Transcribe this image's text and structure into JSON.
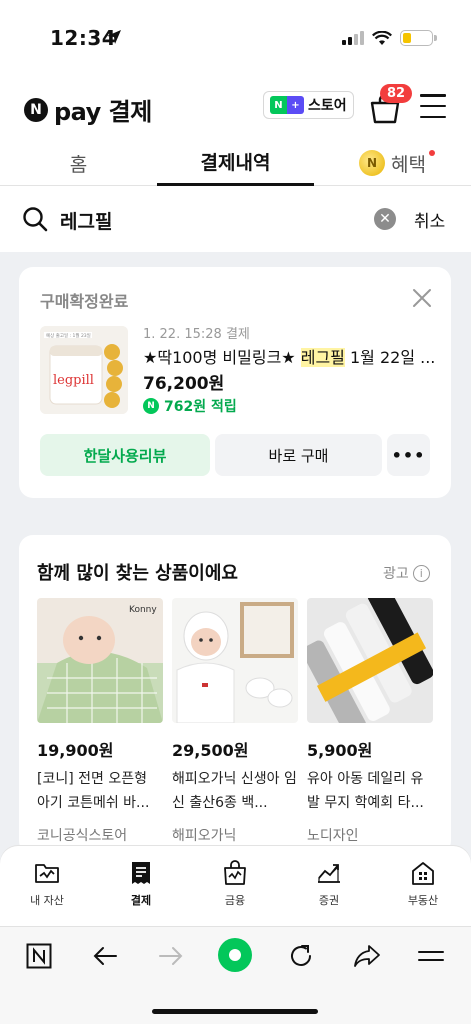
{
  "status_bar": {
    "time": "12:34"
  },
  "header": {
    "logo_letter": "N",
    "logo_text": "pay 결제",
    "store_badge_left": "N",
    "store_badge_right": "+",
    "store_label": "스토어",
    "cart_count": "82"
  },
  "tabs": [
    {
      "label": "홈"
    },
    {
      "label": "결제내역"
    },
    {
      "label": "혜택"
    }
  ],
  "search": {
    "query": "레그필",
    "cancel_label": "취소"
  },
  "order": {
    "status": "구매확정완료",
    "thumb_banner": "예상 출고일 : 1월 23일",
    "thumb_brand": "legpill",
    "date": "1. 22. 15:28 결제",
    "title_prefix": "★딱100명 비밀링크★ ",
    "title_highlight": "레그필",
    "title_suffix": " 1월 22일 ...",
    "price": "76,200원",
    "points": "762원 적립",
    "review_button": "한달사용리뷰",
    "buy_button": "바로 구매",
    "more_button": "•••"
  },
  "recommend": {
    "title": "함께 많이 찾는 상품이에요",
    "ad_label": "광고",
    "items": [
      {
        "price": "19,900원",
        "name": "[코니] 전면 오픈형 아기 코튼메쉬 바...",
        "seller": "코니공식스토어",
        "image_brand": "Konny"
      },
      {
        "price": "29,500원",
        "name": "해피오가닉 신생아 임신 출산6종 백...",
        "seller": "해피오가닉"
      },
      {
        "price": "5,900원",
        "name": "유아 아동 데일리 유발 무지 학예회 타...",
        "seller": "노디자인"
      }
    ]
  },
  "bottom_nav": [
    {
      "label": "내 자산",
      "icon": "folder-chart-icon"
    },
    {
      "label": "결제",
      "icon": "receipt-icon"
    },
    {
      "label": "금융",
      "icon": "bag-chart-icon"
    },
    {
      "label": "증권",
      "icon": "stock-chart-icon"
    },
    {
      "label": "부동산",
      "icon": "building-icon"
    }
  ],
  "colors": {
    "accent_green": "#03c75a",
    "badge_red": "#f23d3d",
    "highlight": "#fff4a3"
  }
}
